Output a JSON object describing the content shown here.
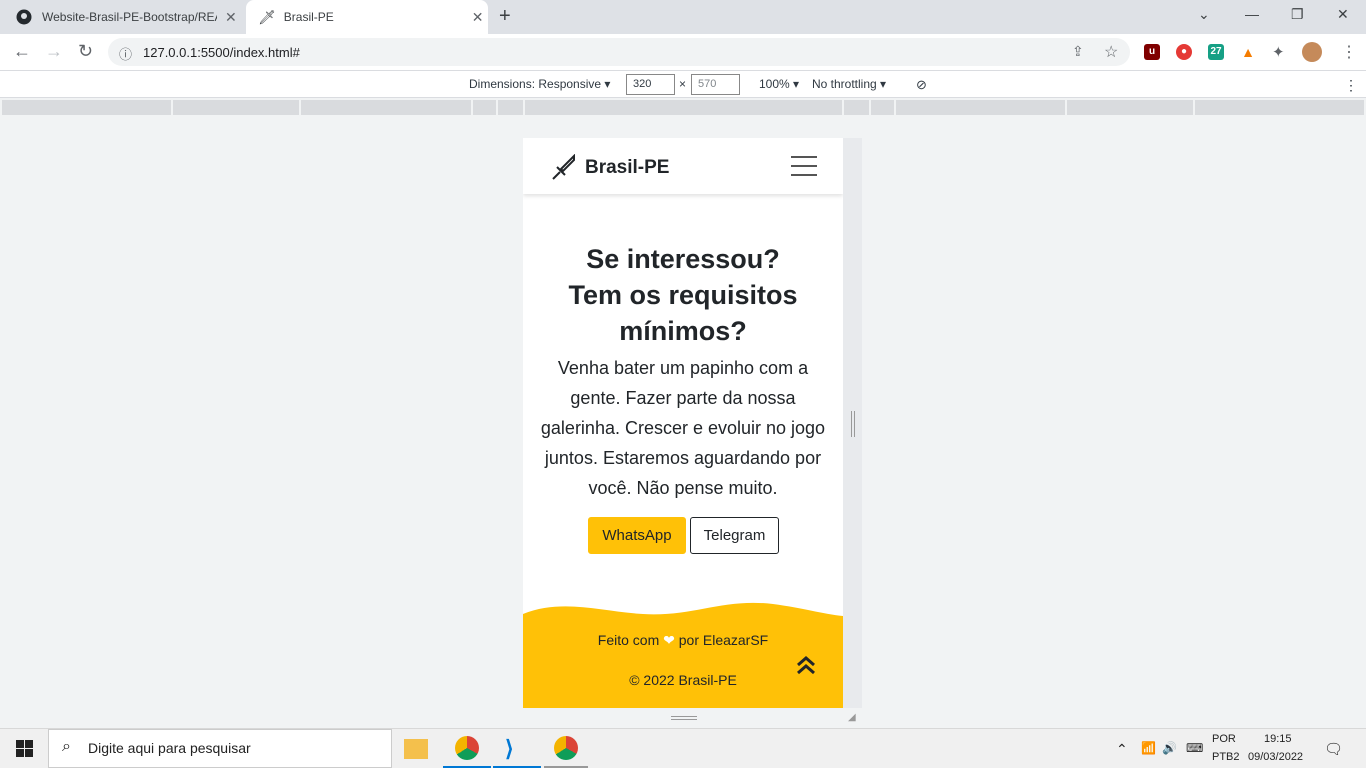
{
  "browser": {
    "tabs": [
      {
        "title": "Website-Brasil-PE-Bootstrap/REA"
      },
      {
        "title": "Brasil-PE"
      }
    ],
    "url": "127.0.0.1:5500/index.html#"
  },
  "devtools": {
    "dimensions": "Dimensions: Responsive",
    "width": "320",
    "height": "570",
    "zoom": "100%",
    "throttle": "No throttling",
    "times": "×"
  },
  "page": {
    "brand": "Brasil-PE",
    "heading_lines": [
      "Se interessou?",
      "Tem os requisitos",
      "mínimos?"
    ],
    "paragraph": "Venha bater um papinho com a gente. Fazer parte da nossa galerinha. Crescer e evoluir no jogo juntos. Estaremos aguardando por você. Não pense muito.",
    "buttons": {
      "whatsapp": "WhatsApp",
      "telegram": "Telegram"
    },
    "footer": {
      "made_with": "Feito com",
      "by": "por EleazarSF",
      "copyright": "© 2022 Brasil-PE"
    },
    "colors": {
      "accent": "#ffc107",
      "text": "#212529"
    }
  },
  "taskbar": {
    "search_placeholder": "Digite aqui para pesquisar",
    "lang1": "POR",
    "lang2": "PTB2",
    "time": "19:15",
    "date": "09/03/2022"
  }
}
